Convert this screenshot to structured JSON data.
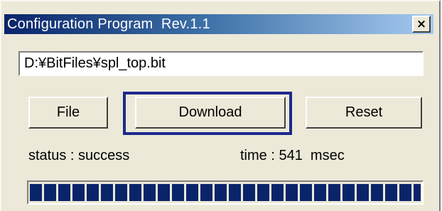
{
  "window": {
    "title": "Configuration Program  Rev.1.1",
    "close_label": "×"
  },
  "file_path": {
    "value": "D:¥BitFiles¥spl_top.bit"
  },
  "buttons": {
    "file": "File",
    "download": "Download",
    "reset": "Reset"
  },
  "status": {
    "status_text": "status : success",
    "time_text": "time : 541  msec"
  },
  "progress": {
    "fraction": 1.0
  },
  "colors": {
    "titlebar_start": "#0a246a",
    "titlebar_end": "#a6caf0",
    "highlight_border": "#1c2a8c",
    "progress_block": "#0a246a",
    "window_bg": "#ece9d8"
  }
}
